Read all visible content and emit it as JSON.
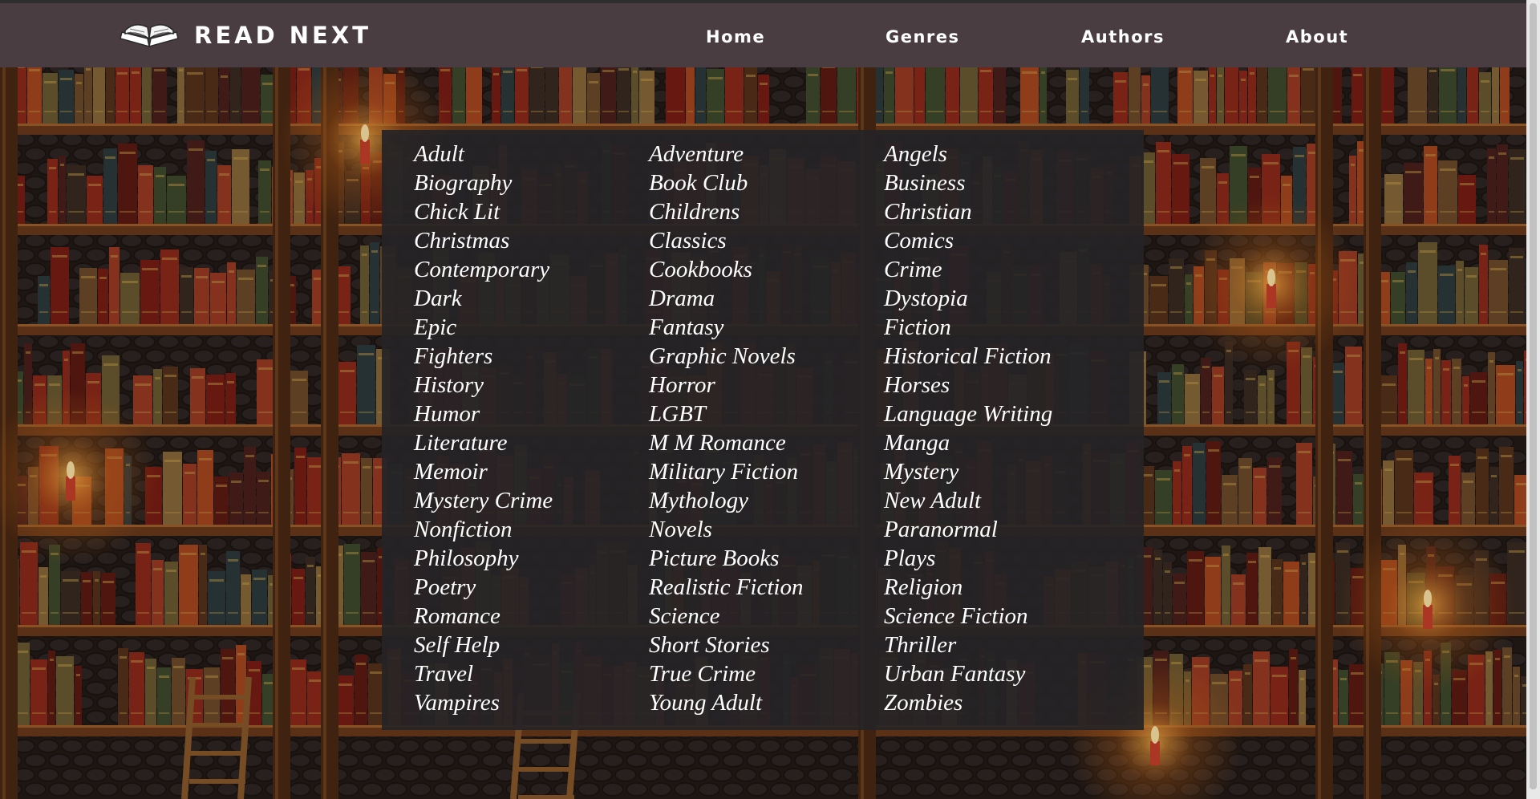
{
  "brand": {
    "name": "READ NEXT",
    "logo_icon": "open-book-icon"
  },
  "nav": {
    "items": [
      {
        "label": "Home"
      },
      {
        "label": "Genres"
      },
      {
        "label": "Authors"
      },
      {
        "label": "About"
      }
    ]
  },
  "colors": {
    "navbar": "#4a3d41",
    "panel": "#262426",
    "text": "#ffffff",
    "candle": "#f5a623"
  },
  "genres": [
    "Adult",
    "Adventure",
    "Angels",
    "Biography",
    "Book Club",
    "Business",
    "Chick Lit",
    "Childrens",
    "Christian",
    "Christmas",
    "Classics",
    "Comics",
    "Contemporary",
    "Cookbooks",
    "Crime",
    "Dark",
    "Drama",
    "Dystopia",
    "Epic",
    "Fantasy",
    "Fiction",
    "Fighters",
    "Graphic Novels",
    "Historical Fiction",
    "History",
    "Horror",
    "Horses",
    "Humor",
    "LGBT",
    "Language Writing",
    "Literature",
    "M M Romance",
    "Manga",
    "Memoir",
    "Military Fiction",
    "Mystery",
    "Mystery Crime",
    "Mythology",
    "New Adult",
    "Nonfiction",
    "Novels",
    "Paranormal",
    "Philosophy",
    "Picture Books",
    "Plays",
    "Poetry",
    "Realistic Fiction",
    "Religion",
    "Romance",
    "Science",
    "Science Fiction",
    "Self Help",
    "Short Stories",
    "Thriller",
    "Travel",
    "True Crime",
    "Urban Fantasy",
    "Vampires",
    "Young Adult",
    "Zombies"
  ]
}
